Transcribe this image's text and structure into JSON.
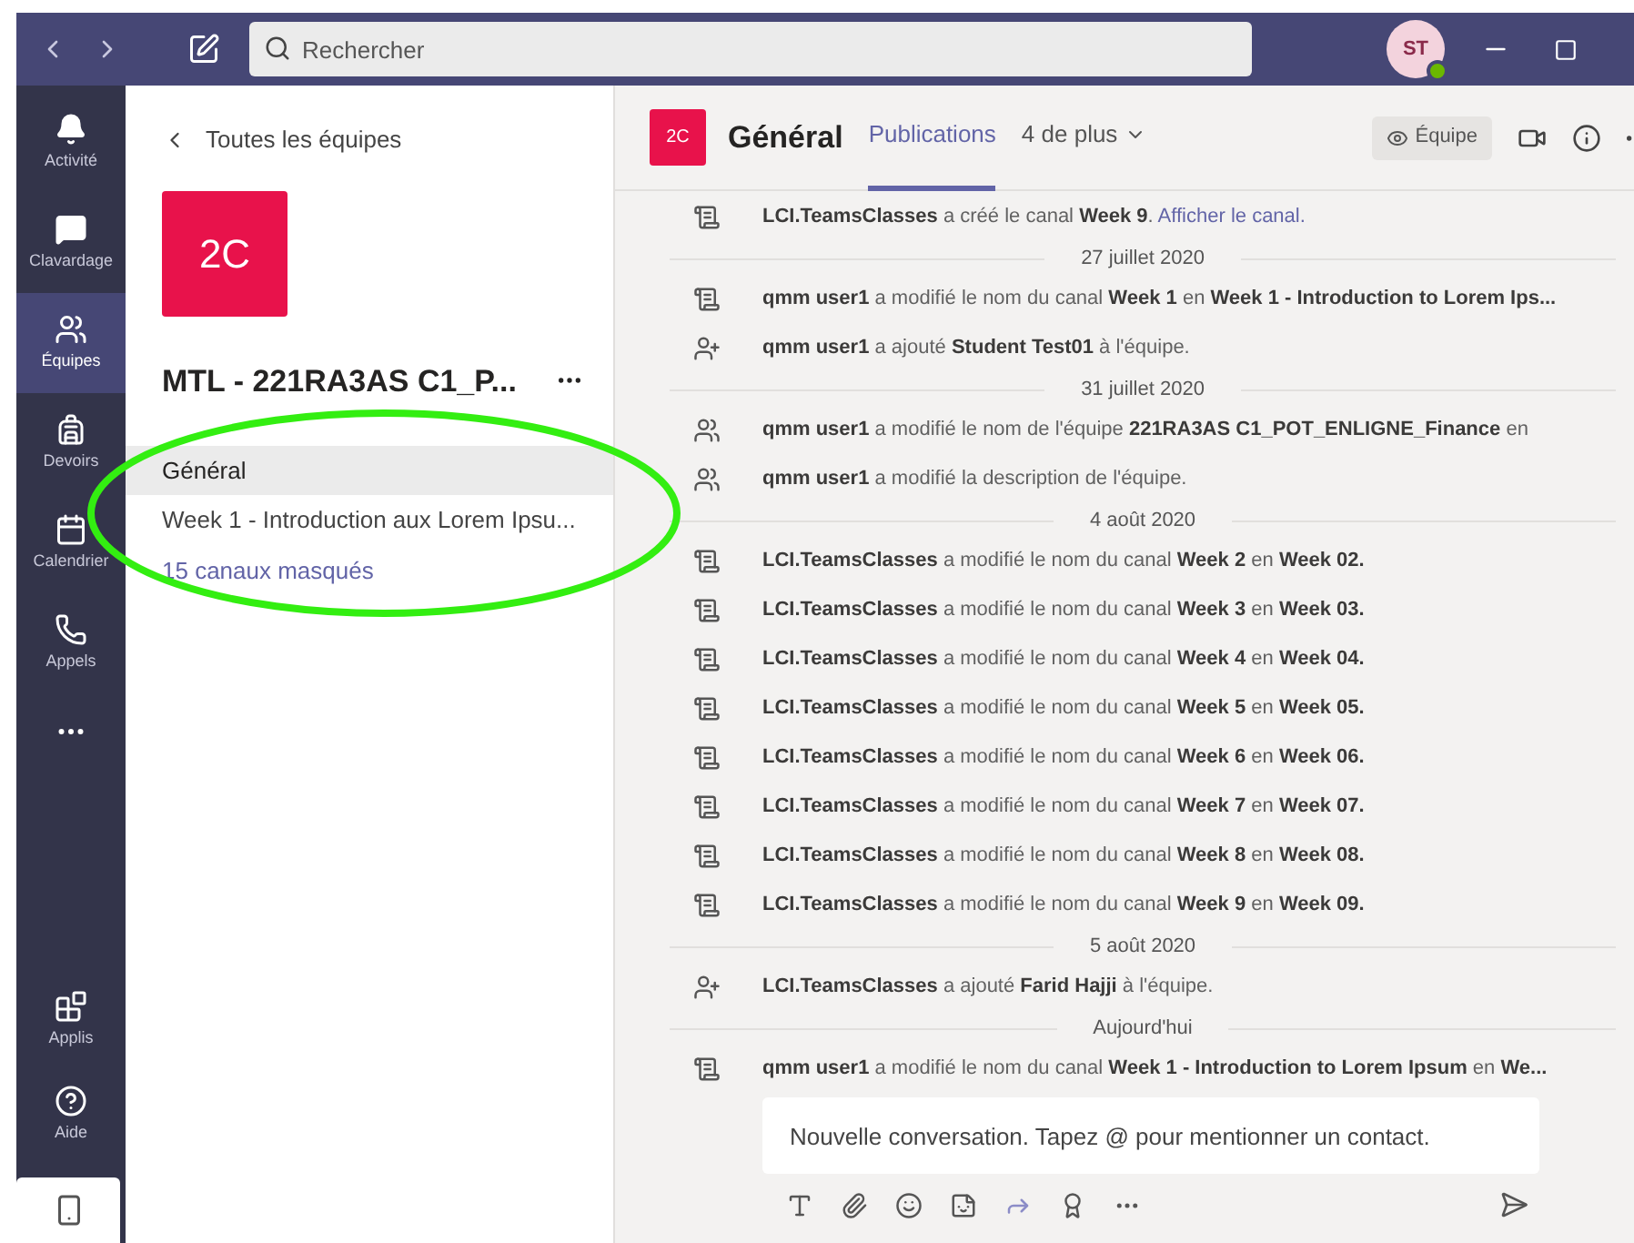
{
  "top_bar": {
    "search": {
      "placeholder": "Rechercher"
    },
    "avatar": {
      "initials": "ST"
    }
  },
  "rail": {
    "items": [
      {
        "label": "Activité",
        "selected": false
      },
      {
        "label": "Clavardage",
        "selected": false
      },
      {
        "label": "Équipes",
        "selected": true
      },
      {
        "label": "Devoirs",
        "selected": false
      },
      {
        "label": "Calendrier",
        "selected": false
      },
      {
        "label": "Appels",
        "selected": false
      }
    ],
    "bottom_items": [
      {
        "label": "Applis"
      },
      {
        "label": "Aide"
      }
    ]
  },
  "team_panel": {
    "back_link": "Toutes les équipes",
    "tile": "2C",
    "name": "MTL - 221RA3AS C1_P...",
    "channels": [
      {
        "name": "Général",
        "selected": true
      },
      {
        "name": "Week 1 - Introduction aux Lorem Ipsu...",
        "selected": false
      }
    ],
    "hidden_channels": "15 canaux masqués"
  },
  "header": {
    "tile": "2C",
    "title": "Général",
    "tabs": [
      {
        "label": "Publications",
        "selected": true
      },
      {
        "label": "4 de plus",
        "selected": false
      }
    ],
    "team_button": "Équipe"
  },
  "feed": [
    {
      "kind": "channel",
      "text": "**LCI.TeamsClasses** a créé le canal **Week 9**.",
      "link": "Afficher le canal."
    },
    {
      "kind": "date",
      "text": "27 juillet 2020"
    },
    {
      "kind": "channel",
      "text": "**qmm user1** a modifié le nom du canal **Week 1** en **Week 1 - Introduction to Lorem Ips...**"
    },
    {
      "kind": "member",
      "text": "**qmm user1** a ajouté **Student Test01** à l'équipe."
    },
    {
      "kind": "date",
      "text": "31 juillet 2020"
    },
    {
      "kind": "team",
      "text": "**qmm user1** a modifié le nom de l'équipe **221RA3AS C1_POT_ENLIGNE_Finance** en"
    },
    {
      "kind": "team",
      "text": "**qmm user1** a modifié la description de l'équipe."
    },
    {
      "kind": "date",
      "text": "4 août 2020"
    },
    {
      "kind": "channel",
      "text": "**LCI.TeamsClasses** a modifié le nom du canal **Week 2** en **Week 02.**"
    },
    {
      "kind": "channel",
      "text": "**LCI.TeamsClasses** a modifié le nom du canal **Week 3** en **Week 03.**"
    },
    {
      "kind": "channel",
      "text": "**LCI.TeamsClasses** a modifié le nom du canal **Week 4** en **Week 04.**"
    },
    {
      "kind": "channel",
      "text": "**LCI.TeamsClasses** a modifié le nom du canal **Week 5** en **Week 05.**"
    },
    {
      "kind": "channel",
      "text": "**LCI.TeamsClasses** a modifié le nom du canal **Week 6** en **Week 06.**"
    },
    {
      "kind": "channel",
      "text": "**LCI.TeamsClasses** a modifié le nom du canal **Week 7** en **Week 07.**"
    },
    {
      "kind": "channel",
      "text": "**LCI.TeamsClasses** a modifié le nom du canal **Week 8** en **Week 08.**"
    },
    {
      "kind": "channel",
      "text": "**LCI.TeamsClasses** a modifié le nom du canal **Week 9** en **Week 09.**"
    },
    {
      "kind": "date",
      "text": "5 août 2020"
    },
    {
      "kind": "member",
      "text": "**LCI.TeamsClasses** a ajouté **Farid Hajji** à l'équipe."
    },
    {
      "kind": "date",
      "text": "Aujourd'hui"
    },
    {
      "kind": "channel",
      "text": "**qmm user1** a modifié le nom du canal **Week 1 - Introduction to Lorem Ipsum** en **We...**"
    }
  ],
  "compose": {
    "placeholder": "Nouvelle conversation. Tapez @ pour mentionner un contact."
  }
}
